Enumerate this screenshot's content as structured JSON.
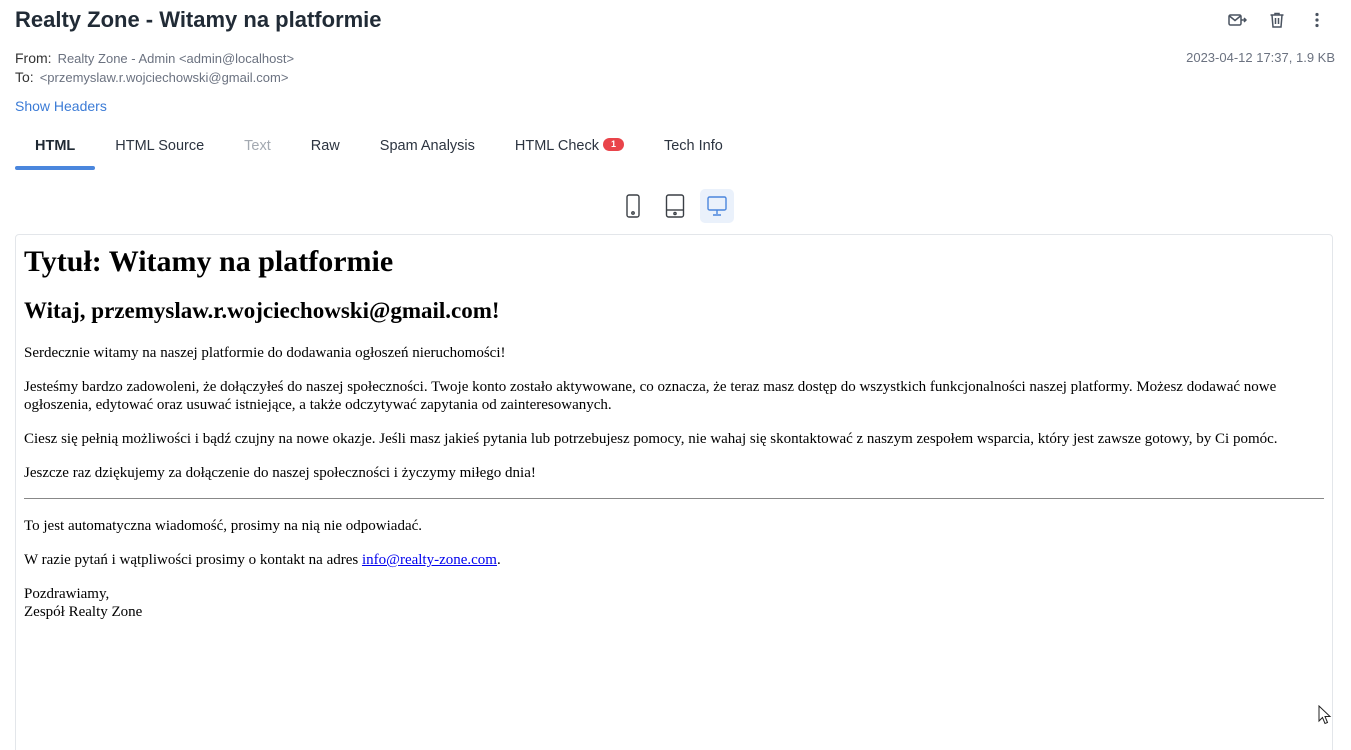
{
  "subject": "Realty Zone - Witamy na platformie",
  "toolbar": {
    "icons": [
      "mail-forward-icon",
      "trash-icon",
      "more-vertical-icon"
    ]
  },
  "meta": {
    "from_label": "From:",
    "from_value": "Realty Zone - Admin <admin@localhost>",
    "to_label": "To:",
    "to_value": "<przemyslaw.r.wojciechowski@gmail.com>",
    "date_size": "2023-04-12 17:37, 1.9 KB"
  },
  "show_headers": "Show Headers",
  "tabs": [
    {
      "label": "HTML",
      "state": "active"
    },
    {
      "label": "HTML Source",
      "state": "normal"
    },
    {
      "label": "Text",
      "state": "disabled"
    },
    {
      "label": "Raw",
      "state": "normal"
    },
    {
      "label": "Spam Analysis",
      "state": "normal"
    },
    {
      "label": "HTML Check",
      "state": "normal",
      "badge": "1"
    },
    {
      "label": "Tech Info",
      "state": "normal"
    }
  ],
  "devices": {
    "options": [
      "phone-icon",
      "tablet-icon",
      "desktop-icon"
    ],
    "selected": "desktop-icon"
  },
  "email": {
    "title": "Tytuł: Witamy na platformie",
    "greeting": "Witaj, przemyslaw.r.wojciechowski@gmail.com!",
    "p1": "Serdecznie witamy na naszej platformie do dodawania ogłoszeń nieruchomości!",
    "p2": "Jesteśmy bardzo zadowoleni, że dołączyłeś do naszej społeczności. Twoje konto zostało aktywowane, co oznacza, że teraz masz dostęp do wszystkich funkcjonalności naszej platformy. Możesz dodawać nowe ogłoszenia, edytować oraz usuwać istniejące, a także odczytywać zapytania od zainteresowanych.",
    "p3": "Ciesz się pełnią możliwości i bądź czujny na nowe okazje. Jeśli masz jakieś pytania lub potrzebujesz pomocy, nie wahaj się skontaktować z naszym zespołem wsparcia, który jest zawsze gotowy, by Ci pomóc.",
    "p4": "Jeszcze raz dziękujemy za dołączenie do naszej społeczności i życzymy miłego dnia!",
    "auto_note": "To jest automatyczna wiadomość, prosimy na nią nie odpowiadać.",
    "contact_prefix": "W razie pytań i wątpliwości prosimy o kontakt na adres ",
    "contact_link": "info@realty-zone.com",
    "contact_suffix": ".",
    "closing": "Pozdrawiamy,",
    "signature": "Zespół Realty Zone"
  },
  "colors": {
    "accent": "#4a86dd",
    "badge": "#e9444a",
    "link": "#3b7bd6"
  }
}
